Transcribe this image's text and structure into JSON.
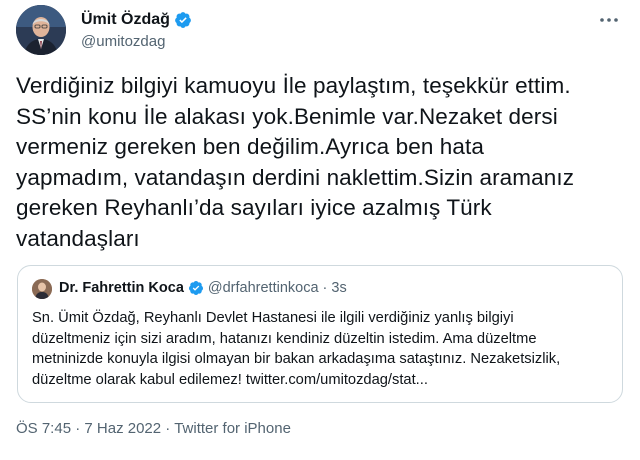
{
  "author": {
    "name": "Ümit Özdağ",
    "handle": "@umitozdag",
    "verified": true
  },
  "tweet": {
    "text": "Verdiğiniz bilgiyi kamuoyu İle paylaştım, teşekkür ettim.\nSS’nin konu İle alakası yok.Benimle var.Nezaket dersi\nvermeniz gereken ben değilim.Ayrıca ben hata\nyapmadım, vatandaşın derdini naklettim.Sizin aramanız\ngereken Reyhanlı’da sayıları iyice azalmış Türk\nvatandaşları"
  },
  "quoted": {
    "name": "Dr. Fahrettin Koca",
    "handle": "@drfahrettinkoca",
    "separator": "·",
    "time": "3s",
    "text": "Sn. Ümit Özdağ, Reyhanlı Devlet Hastanesi ile ilgili verdiğiniz yanlış bilgiyi\ndüzeltmeniz için sizi aradım, hatanızı kendiniz düzeltin istedim. Ama düzeltme\nmetninizde konuyla ilgisi olmayan bir bakan arkadaşıma sataştınız. Nezaketsizlik,\ndüzeltme olarak kabul edilemez! twitter.com/umitozdag/stat..."
  },
  "meta": {
    "time": "ÖS 7:45",
    "separator1": "·",
    "date": "7 Haz 2022",
    "separator2": "·",
    "source": "Twitter for iPhone"
  },
  "icons": {
    "verified": "verified-badge-icon",
    "more": "more-dots-icon"
  },
  "colors": {
    "verified": "#1d9bf0",
    "secondary_text": "#536471",
    "primary_text": "#0f1419",
    "border": "#cfd9de"
  }
}
